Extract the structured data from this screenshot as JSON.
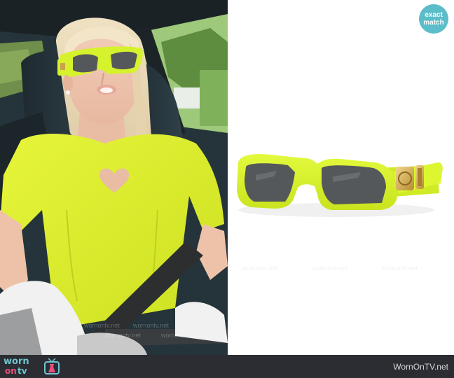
{
  "badge": {
    "line1": "exact",
    "line2": "match"
  },
  "footer": {
    "logo_worn": "worn",
    "logo_on": "on",
    "logo_tv": "tv",
    "site_name": "WornOnTV.net"
  },
  "watermark": {
    "text": "wornontv.net"
  },
  "colors": {
    "neon_yellow": "#d6f22c",
    "lens": "#55585a",
    "gold": "#c9a24a",
    "badge": "#5bbdc9",
    "footer_bg": "#2b2d33"
  }
}
